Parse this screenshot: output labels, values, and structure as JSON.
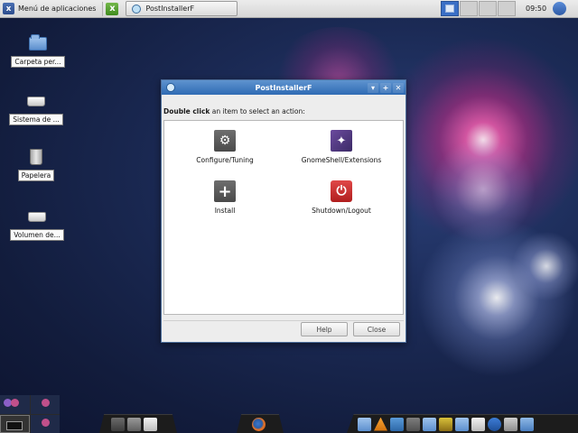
{
  "top_panel": {
    "menu_label": "Menú de aplicaciones",
    "task_label": "PostInstallerF",
    "clock": "09:50"
  },
  "desktop": {
    "icons": [
      {
        "label": "Carpeta per...",
        "icon": "folder-icon"
      },
      {
        "label": "Sistema de ...",
        "icon": "drive-icon"
      },
      {
        "label": "Papelera",
        "icon": "trash-icon"
      },
      {
        "label": "Volumen de...",
        "icon": "drive-icon"
      }
    ]
  },
  "dialog": {
    "title": "PostInstallerF",
    "prompt_bold": "Double click",
    "prompt_rest": " an item to select an action:",
    "actions": [
      {
        "label": "Configure/Tuning",
        "icon": "gear-icon"
      },
      {
        "label": "GnomeShell/Extensions",
        "icon": "magic-wand-icon"
      },
      {
        "label": "Install",
        "icon": "plus-icon"
      },
      {
        "label": "Shutdown/Logout",
        "icon": "power-icon"
      }
    ],
    "help_label": "Help",
    "close_label": "Close",
    "controls": {
      "minimize": "▾",
      "maximize": "+",
      "close": "✕"
    }
  },
  "colors": {
    "titlebar": "#2f6bb4",
    "active_workspace": "#3a6fc6",
    "power_button": "#b01e1e"
  }
}
